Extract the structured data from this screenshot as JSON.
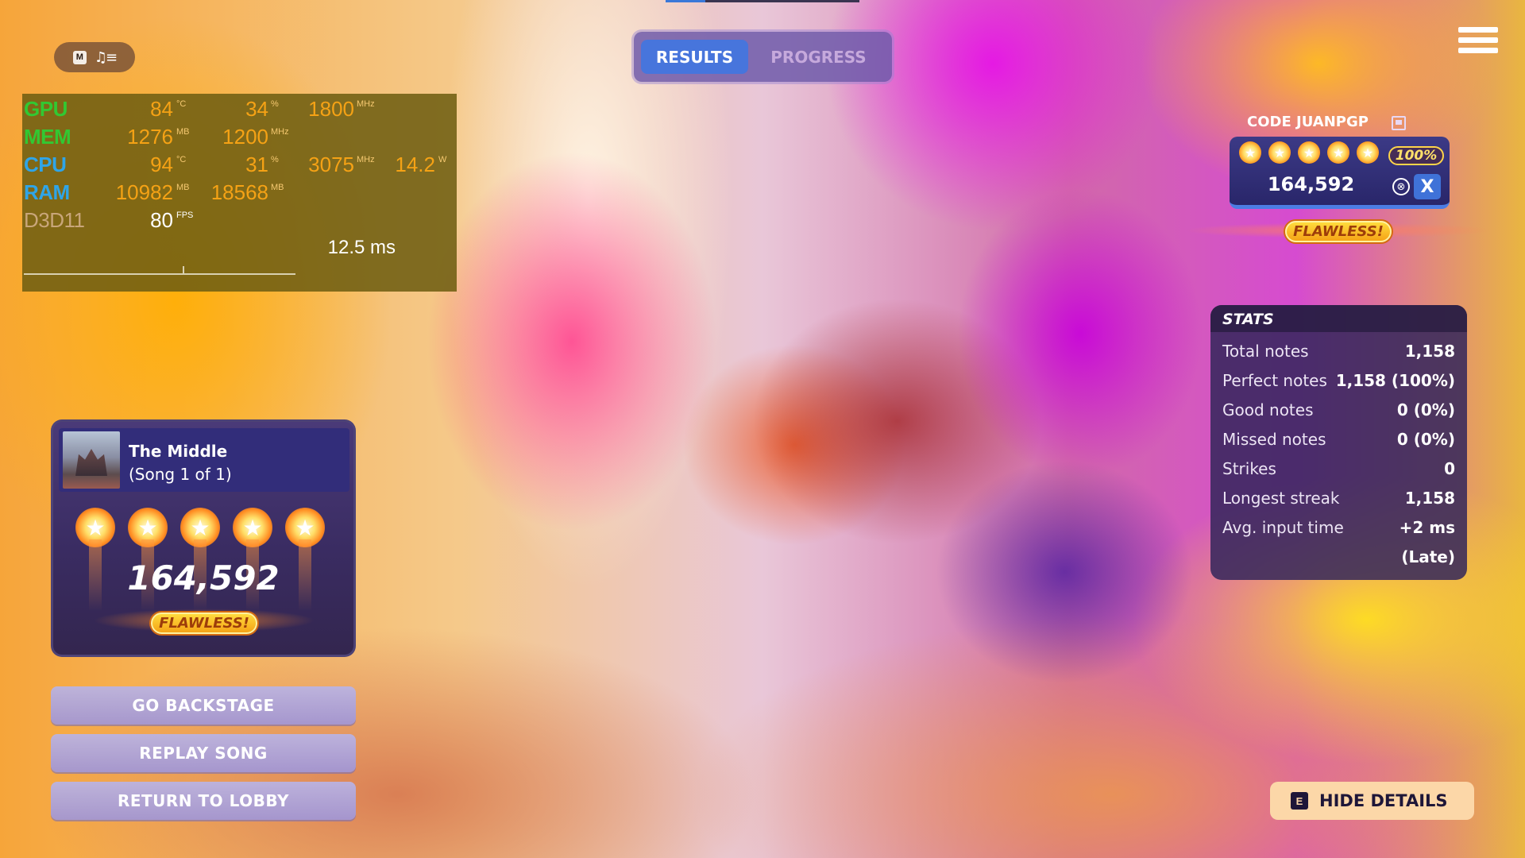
{
  "overlay_toggle": {
    "key": "M",
    "icon": "music-list-icon",
    "glyph": "♫≡"
  },
  "perf": {
    "rows": [
      {
        "label": "GPU",
        "values": [
          "84",
          "34",
          "1800"
        ],
        "units": [
          "°C",
          "%",
          "MHz"
        ]
      },
      {
        "label": "MEM",
        "values": [
          "1276",
          "1200"
        ],
        "units": [
          "MB",
          "MHz"
        ]
      },
      {
        "label": "CPU",
        "values": [
          "94",
          "31",
          "3075",
          "14.2"
        ],
        "units": [
          "°C",
          "%",
          "MHz",
          "W"
        ]
      },
      {
        "label": "RAM",
        "values": [
          "10982",
          "18568"
        ],
        "units": [
          "MB",
          "MB"
        ]
      },
      {
        "label": "D3D11",
        "values": [
          "80"
        ],
        "units": [
          "FPS"
        ]
      }
    ],
    "frametime": "12.5 ms"
  },
  "tabs": {
    "results": "RESULTS",
    "progress": "PROGRESS",
    "active": "results"
  },
  "menu_icon": "hamburger-menu-icon",
  "player": {
    "name": "CODE JUANPGP",
    "stars": 5,
    "accuracy": "100%",
    "score": "164,592",
    "platform_badge": "X",
    "rating": "FLAWLESS!"
  },
  "stats": {
    "title": "STATS",
    "rows": [
      {
        "label": "Total notes",
        "value": "1,158"
      },
      {
        "label": "Perfect notes",
        "value": "1,158 (100%)"
      },
      {
        "label": "Good notes",
        "value": "0 (0%)"
      },
      {
        "label": "Missed notes",
        "value": "0 (0%)"
      },
      {
        "label": "Strikes",
        "value": "0"
      },
      {
        "label": "Longest streak",
        "value": "1,158"
      },
      {
        "label": "Avg. input time",
        "value": "+2 ms"
      },
      {
        "label": "",
        "value": "(Late)"
      }
    ]
  },
  "song": {
    "title": "The Middle",
    "subtitle": "(Song 1 of 1)",
    "stars": 5,
    "score": "164,592",
    "rating": "FLAWLESS!"
  },
  "actions": {
    "backstage": "GO BACKSTAGE",
    "replay": "REPLAY SONG",
    "lobby": "RETURN TO LOBBY"
  },
  "hide_details": {
    "key": "E",
    "label": "HIDE DETAILS"
  },
  "colors": {
    "tab_active": "#4775dc",
    "flawless": "#ffdb3d",
    "stats_bg": "#32265a",
    "hide_btn": "#fcd7a8"
  }
}
